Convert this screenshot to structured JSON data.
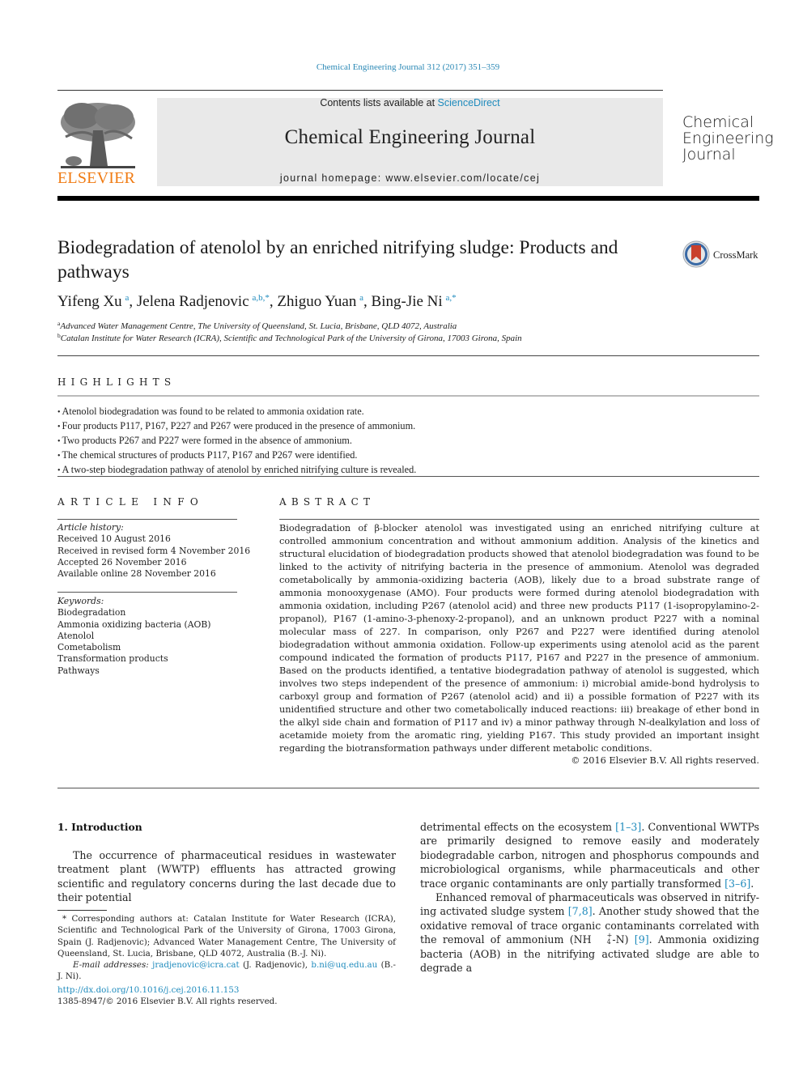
{
  "header": {
    "citation": "Chemical Engineering Journal 312 (2017) 351–359",
    "contents_prefix": "Contents lists available at ",
    "contents_link": "ScienceDirect",
    "journal_title": "Chemical Engineering Journal",
    "homepage": "journal homepage: www.elsevier.com/locate/cej",
    "publisher_logo_text": "ELSEVIER",
    "journal_logo_lines": [
      "Chemical",
      "Engineering",
      "Journal"
    ],
    "colors": {
      "link": "#1f8bbd",
      "elsevier_orange": "#f07b13",
      "banner_bg": "#e9e9e9"
    }
  },
  "article": {
    "title": "Biodegradation of atenolol by an enriched nitrifying sludge: Products and pathways",
    "crossmark_label": "CrossMark",
    "authors": [
      {
        "name": "Yifeng Xu",
        "sup": "a"
      },
      {
        "name": "Jelena Radjenovic",
        "sup": "a,b,*"
      },
      {
        "name": "Zhiguo Yuan",
        "sup": "a"
      },
      {
        "name": "Bing-Jie Ni",
        "sup": "a,*"
      }
    ],
    "affiliations": [
      {
        "label": "a",
        "text": "Advanced Water Management Centre, The University of Queensland, St. Lucia, Brisbane, QLD 4072, Australia"
      },
      {
        "label": "b",
        "text": "Catalan Institute for Water Research (ICRA), Scientific and Technological Park of the University of Girona, 17003 Girona, Spain"
      }
    ]
  },
  "highlights": {
    "heading": "HIGHLIGHTS",
    "items": [
      "Atenolol biodegradation was found to be related to ammonia oxidation rate.",
      "Four products P117, P167, P227 and P267 were produced in the presence of ammonium.",
      "Two products P267 and P227 were formed in the absence of ammonium.",
      "The chemical structures of products P117, P167 and P267 were identified.",
      "A two-step biodegradation pathway of atenolol by enriched nitrifying culture is revealed."
    ]
  },
  "article_info": {
    "heading": "ARTICLE INFO",
    "history_label": "Article history:",
    "history": [
      "Received 10 August 2016",
      "Received in revised form 4 November 2016",
      "Accepted 26 November 2016",
      "Available online 28 November 2016"
    ],
    "keywords_label": "Keywords:",
    "keywords": [
      "Biodegradation",
      "Ammonia oxidizing bacteria (AOB)",
      "Atenolol",
      "Cometabolism",
      "Transformation products",
      "Pathways"
    ]
  },
  "abstract": {
    "heading": "ABSTRACT",
    "text": "Biodegradation of β-blocker atenolol was investigated using an enriched nitrifying culture at controlled ammonium concentration and without ammonium addition. Analysis of the kinetics and structural elu­cidation of biodegradation products showed that atenolol biodegradation was found to be linked to the activity of nitrifying bacteria in the presence of ammonium. Atenolol was degraded cometabolically by ammonia-oxidizing bacteria (AOB), likely due to a broad substrate range of ammonia monooxygenase (AMO). Four products were formed during atenolol biodegradation with ammonia oxidation, including P267 (atenolol acid) and three new products P117 (1-isopropylamino-2-propanol), P167 (1-amino-3-phenoxy-2-propanol), and an unknown product P227 with a nominal molecular mass of 227. In compar­ison, only P267 and P227 were identified during atenolol biodegradation without ammonia oxidation. Follow-up experiments using atenolol acid as the parent compound indicated the formation of products P117, P167 and P227 in the presence of ammonium. Based on the products identified, a tentative biodegradation pathway of atenolol is suggested, which involves two steps independent of the presence of ammonium: i) microbial amide-bond hydrolysis to carboxyl group and formation of P267 (atenolol acid) and ii) a possible formation of P227 with its unidentified structure and other two cometabolically induced reactions: iii) breakage of ether bond in the alkyl side chain and formation of P117 and iv) a minor pathway through N-dealkylation and loss of acetamide moiety from the aromatic ring, yielding P167. This study provided an important insight regarding the biotransformation pathways under differ­ent metabolic conditions.",
    "copyright": "© 2016 Elsevier B.V. All rights reserved."
  },
  "body": {
    "section_heading": "1. Introduction",
    "left_para": "The occurrence of pharmaceutical residues in wastewater treat­ment plant (WWTP) effluents has attracted growing scientific and regulatory concerns during the last decade due to their potential",
    "right_para1": {
      "t1": "detrimental effects on the ecosystem ",
      "ref1": "[1–3]",
      "t2": ". Conventional WWTPs are primarily designed to remove easily and moderately biodegradable carbon, nitrogen and phosphorus compounds and microbiological organisms, while pharmaceuticals and other trace organic contaminants are only partially transformed ",
      "ref2": "[3–6]",
      "t3": "."
    },
    "right_para2": {
      "t1": "Enhanced removal of pharmaceuticals was observed in nitrify­ing activated sludge system ",
      "ref1": "[7,8]",
      "t2": ". Another study showed that the oxidative removal of trace organic contaminants correlated with the removal of ammonium (NH",
      "sup": "+",
      "sub": "4",
      "t3": "-N) ",
      "ref2": "[9]",
      "t4": ". Ammonia oxidizing bacte­ria (AOB) in the nitrifying activated sludge are able to degrade a"
    }
  },
  "footnotes": {
    "corresponding": "* Corresponding authors at: Catalan Institute for Water Research (ICRA), Scientific and Technological Park of the University of Girona, 17003 Girona, Spain (J. Radjenovic); Advanced Water Management Centre, The University of Queensland, St. Lucia, Brisbane, QLD 4072, Australia (B.-J. Ni).",
    "email_label": "E-mail addresses: ",
    "email1": "jradjenovic@icra.cat",
    "email1_owner": " (J. Radjenovic), ",
    "email2": "b.ni@uq.edu.au",
    "email2_owner": " (B.-J. Ni).",
    "doi": "http://dx.doi.org/10.1016/j.cej.2016.11.153",
    "issn": "1385-8947/© 2016 Elsevier B.V. All rights reserved."
  }
}
